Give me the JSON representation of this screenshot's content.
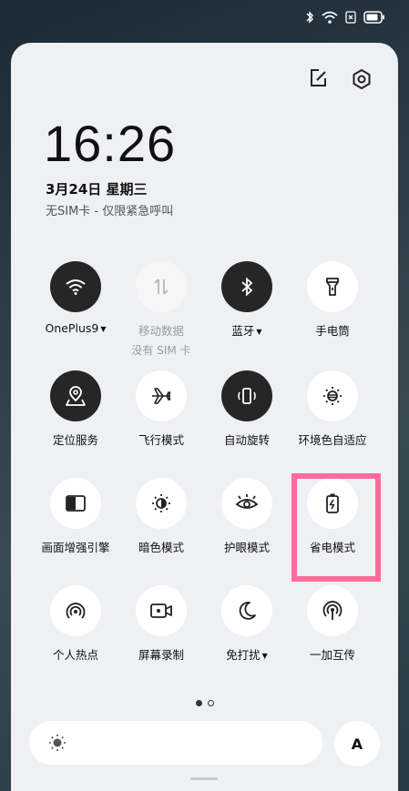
{
  "status_bar": {
    "icons": [
      "bluetooth-icon",
      "wifi-icon",
      "no-sim-icon",
      "battery-icon"
    ]
  },
  "header": {
    "time": "16:26",
    "date": "3月24日  星期三",
    "sim_status": "无SIM卡 - 仅限紧急呼叫",
    "icons": [
      "edit-icon",
      "settings-icon"
    ]
  },
  "tiles": [
    {
      "label": "OnePlus9",
      "dropdown": true,
      "state": "on",
      "icon": "wifi-icon"
    },
    {
      "label": "移动数据",
      "sub": "没有 SIM 卡",
      "state": "disabled",
      "icon": "mobile-data-icon"
    },
    {
      "label": "蓝牙",
      "dropdown": true,
      "state": "on",
      "icon": "bluetooth-icon"
    },
    {
      "label": "手电筒",
      "state": "off",
      "icon": "flashlight-icon"
    },
    {
      "label": "定位服务",
      "state": "on",
      "icon": "location-icon"
    },
    {
      "label": "飞行模式",
      "state": "off",
      "icon": "airplane-icon"
    },
    {
      "label": "自动旋转",
      "state": "on",
      "icon": "rotate-icon"
    },
    {
      "label": "环境色自适应",
      "state": "off",
      "icon": "ambient-display-icon"
    },
    {
      "label": "画面增强引擎",
      "state": "off",
      "icon": "display-engine-icon"
    },
    {
      "label": "暗色模式",
      "state": "off",
      "icon": "dark-mode-icon"
    },
    {
      "label": "护眼模式",
      "state": "off",
      "icon": "eye-comfort-icon"
    },
    {
      "label": "省电模式",
      "state": "off",
      "icon": "battery-saver-icon",
      "highlighted": true
    },
    {
      "label": "个人热点",
      "state": "off",
      "icon": "hotspot-icon"
    },
    {
      "label": "屏幕录制",
      "state": "off",
      "icon": "screen-record-icon"
    },
    {
      "label": "免打扰",
      "dropdown": true,
      "state": "off",
      "icon": "moon-icon"
    },
    {
      "label": "一加互传",
      "state": "off",
      "icon": "share-icon"
    }
  ],
  "pagination": {
    "pages": 2,
    "current": 1
  },
  "brightness": {
    "icon": "sun-icon",
    "auto_label": "A"
  },
  "colors": {
    "panel": "#eef0f3",
    "tile_on": "#262626",
    "highlight": "#ff6b9a"
  }
}
